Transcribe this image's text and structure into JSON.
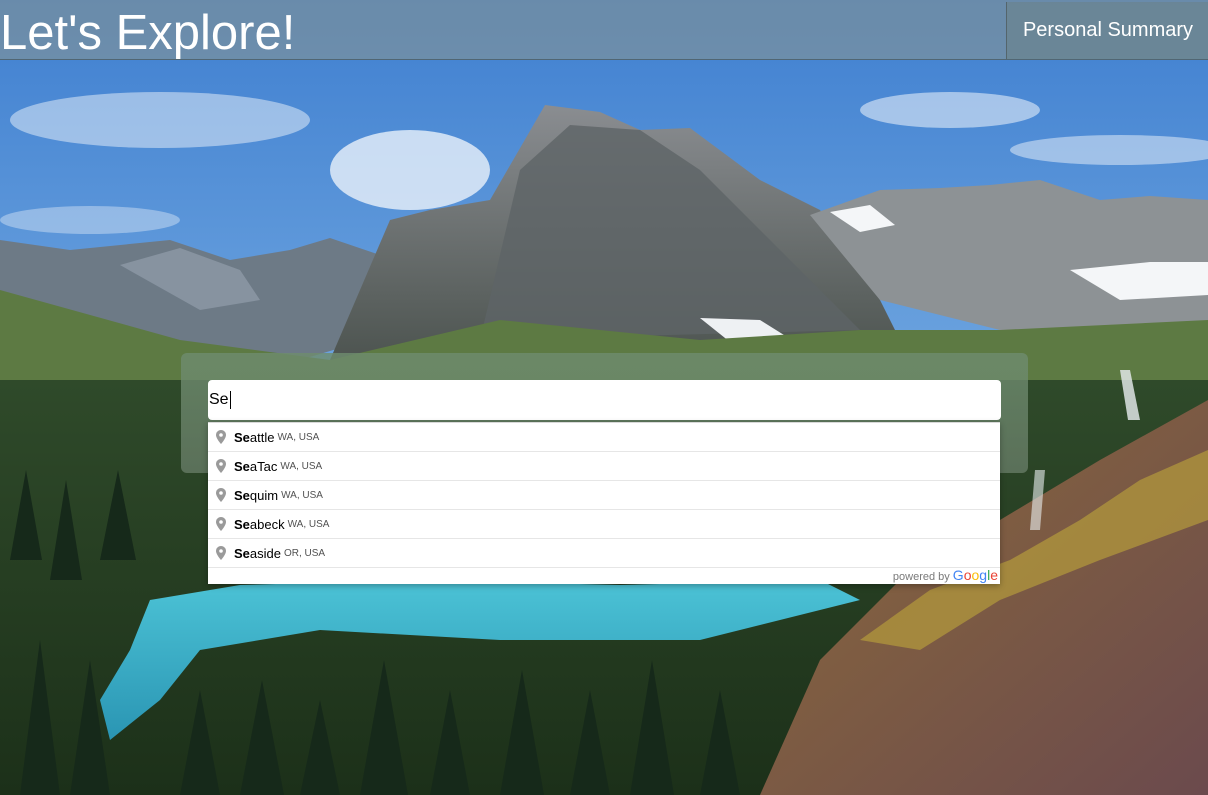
{
  "header": {
    "title": "Let's Explore!",
    "summary_button": "Personal Summary"
  },
  "search": {
    "value": "Se",
    "icon": "map-pin-icon"
  },
  "suggestions": [
    {
      "match": "Se",
      "rest": "attle",
      "secondary": "WA, USA"
    },
    {
      "match": "Se",
      "rest": "aTac",
      "secondary": "WA, USA"
    },
    {
      "match": "Se",
      "rest": "quim",
      "secondary": "WA, USA"
    },
    {
      "match": "Se",
      "rest": "abeck",
      "secondary": "WA, USA"
    },
    {
      "match": "Se",
      "rest": "aside",
      "secondary": "OR, USA"
    }
  ],
  "attribution": {
    "prefix": "powered by",
    "letters": [
      "G",
      "o",
      "o",
      "g",
      "l",
      "e"
    ]
  },
  "colors": {
    "google_blue": "#4285F4",
    "google_red": "#EA4335",
    "google_yellow": "#FBBC05",
    "google_green": "#34A853"
  }
}
